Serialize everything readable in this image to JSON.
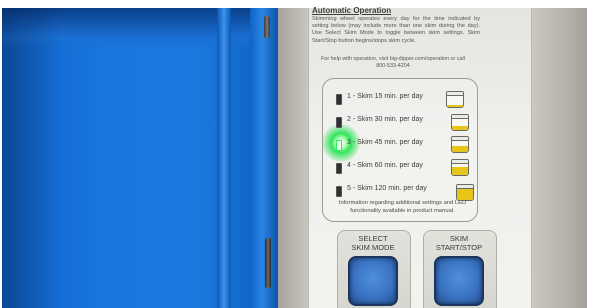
{
  "auto_operation": {
    "title": "Automatic Operation",
    "text": "Skimming wheel operates every day for the time indicated by setting below (may include more than one skim during the day). Use Select Skim Mode to toggle between skim settings. Skim Start/Stop button begins/stops skim cycle.",
    "help": "For help with operation, visit big-dipper.com/operation or call 800-533-4204"
  },
  "skim_modes": [
    {
      "label": "1 - Skim 15 min. per day",
      "active": false,
      "fill_fraction": 0.15
    },
    {
      "label": "2 - Skim 30 min. per day",
      "active": false,
      "fill_fraction": 0.25
    },
    {
      "label": "3 - Skim 45 min. per day",
      "active": true,
      "fill_fraction": 0.4
    },
    {
      "label": "4 - Skim 60 min. per day",
      "active": false,
      "fill_fraction": 0.55
    },
    {
      "label": "5 - Skim 120 min. per day",
      "active": false,
      "fill_fraction": 0.8
    }
  ],
  "info": "Information regarding additional settings and LED functionality available in product manual.",
  "buttons": {
    "select_line1": "SELECT",
    "select_line2": "SKIM MODE",
    "start_line1": "SKIM",
    "start_line2": "START/STOP"
  },
  "colors": {
    "lid": "#1a78de",
    "led_active": "#33e55c",
    "jar_fill": "#e8c51a",
    "button": "#3a74c4"
  }
}
